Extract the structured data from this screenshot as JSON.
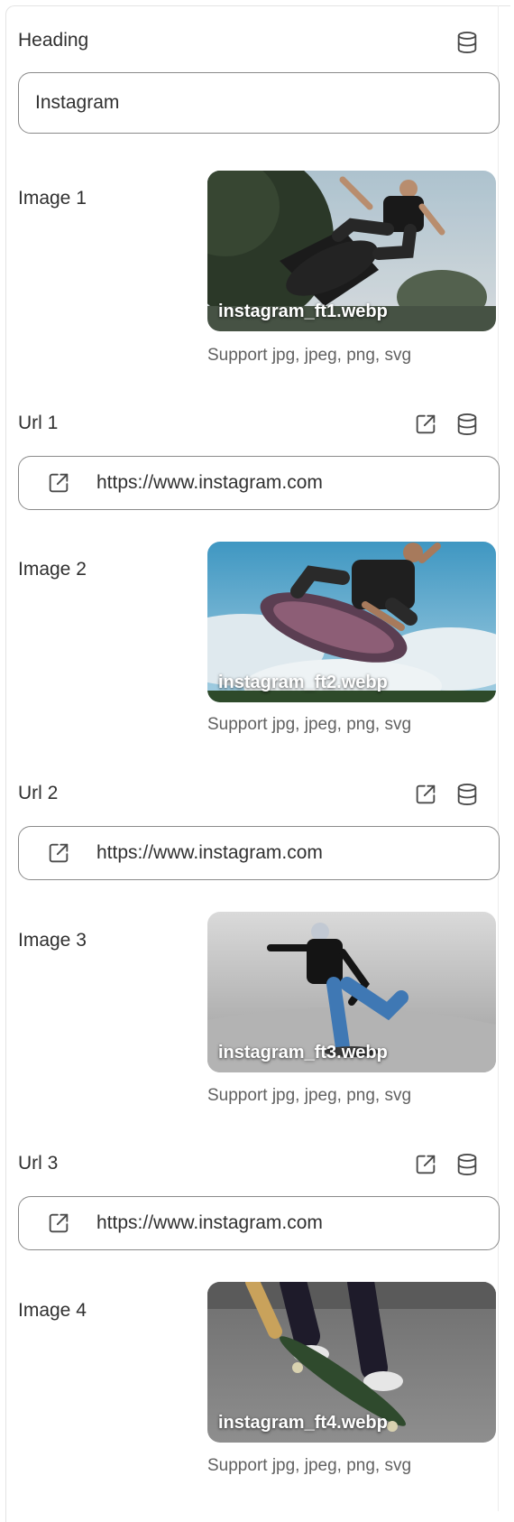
{
  "heading": {
    "label": "Heading",
    "value": "Instagram",
    "source_icon": "database-icon"
  },
  "items": [
    {
      "image_label": "Image 1",
      "filename": "instagram_ft1.webp",
      "hint": "Support jpg, jpeg, png, svg",
      "url_label": "Url 1",
      "url_value": "https://www.instagram.com"
    },
    {
      "image_label": "Image 2",
      "filename": "instagram_ft2.webp",
      "hint": "Support jpg, jpeg, png, svg",
      "url_label": "Url 2",
      "url_value": "https://www.instagram.com"
    },
    {
      "image_label": "Image 3",
      "filename": "instagram_ft3.webp",
      "hint": "Support jpg, jpeg, png, svg",
      "url_label": "Url 3",
      "url_value": "https://www.instagram.com"
    },
    {
      "image_label": "Image 4",
      "filename": "instagram_ft4.webp",
      "hint": "Support jpg, jpeg, png, svg"
    }
  ],
  "icons": {
    "external": "external-link-icon",
    "source": "database-icon"
  },
  "colors": {
    "text": "#303030",
    "muted": "#616161",
    "border": "#8a8a8a"
  }
}
